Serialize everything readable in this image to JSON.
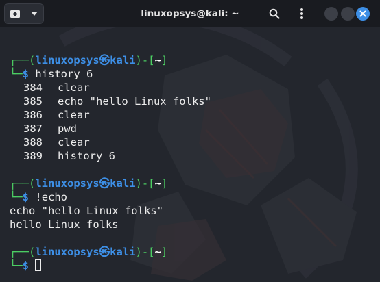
{
  "window": {
    "title": "linuxopsys@kali: ~"
  },
  "header": {
    "new_tab_icon": "new-tab-icon",
    "dropdown_icon": "chevron-down-icon",
    "search_icon": "search-icon",
    "menu_icon": "kebab-menu-icon",
    "close_icon": "close-icon"
  },
  "colors": {
    "prompt_frame": "#4ccf63",
    "user_host": "#3d8fe6",
    "close_button": "#3d8fe6",
    "background": "#23262d"
  },
  "prompt": {
    "open": "┌──(",
    "user": "linuxopsys",
    "at_symbol": "㉿",
    "host": "kali",
    "mid": ")-[",
    "dir": "~",
    "close": "]",
    "second_line": "└─",
    "dollar": "$"
  },
  "session": {
    "command1": "history 6",
    "history": [
      {
        "num": "384",
        "cmd": "clear"
      },
      {
        "num": "385",
        "cmd": "echo \"hello Linux folks\""
      },
      {
        "num": "386",
        "cmd": "clear"
      },
      {
        "num": "387",
        "cmd": "pwd"
      },
      {
        "num": "388",
        "cmd": "clear"
      },
      {
        "num": "389",
        "cmd": "history 6"
      }
    ],
    "command2": "!echo",
    "output2_line1": "echo \"hello Linux folks\"",
    "output2_line2": "hello Linux folks",
    "command3": ""
  }
}
